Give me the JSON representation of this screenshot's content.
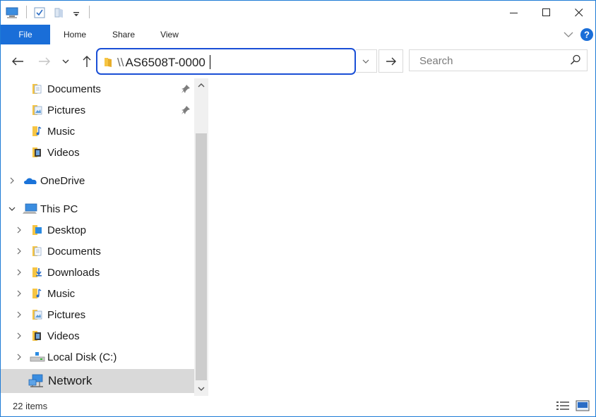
{
  "ribbon": {
    "tabs": [
      {
        "label": "File",
        "active": true
      },
      {
        "label": "Home"
      },
      {
        "label": "Share"
      },
      {
        "label": "View"
      }
    ]
  },
  "address": {
    "prefix": "\\\\",
    "value": "AS6508T-0000"
  },
  "search": {
    "placeholder": "Search"
  },
  "nav": {
    "quick_access": [
      {
        "label": "Documents",
        "icon": "documents-icon",
        "pinned": true
      },
      {
        "label": "Pictures",
        "icon": "pictures-icon",
        "pinned": true
      },
      {
        "label": "Music",
        "icon": "music-icon",
        "pinned": false
      },
      {
        "label": "Videos",
        "icon": "videos-icon",
        "pinned": false
      }
    ],
    "onedrive": {
      "label": "OneDrive",
      "icon": "onedrive-icon",
      "expanded": false
    },
    "this_pc": {
      "label": "This PC",
      "icon": "this-pc-icon",
      "expanded": true
    },
    "this_pc_items": [
      {
        "label": "Desktop",
        "icon": "desktop-icon"
      },
      {
        "label": "Documents",
        "icon": "documents-icon"
      },
      {
        "label": "Downloads",
        "icon": "downloads-icon"
      },
      {
        "label": "Music",
        "icon": "music-icon"
      },
      {
        "label": "Pictures",
        "icon": "pictures-icon"
      },
      {
        "label": "Videos",
        "icon": "videos-icon"
      },
      {
        "label": "Local Disk (C:)",
        "icon": "local-disk-icon"
      }
    ],
    "network": {
      "label": "Network",
      "icon": "network-icon",
      "selected": true
    }
  },
  "status": {
    "items_count": "22 items"
  },
  "colors": {
    "accent": "#1a6ed8",
    "address_focus": "#1a4fd6",
    "selection": "#d9d9d9",
    "folder": "#f6c544"
  }
}
